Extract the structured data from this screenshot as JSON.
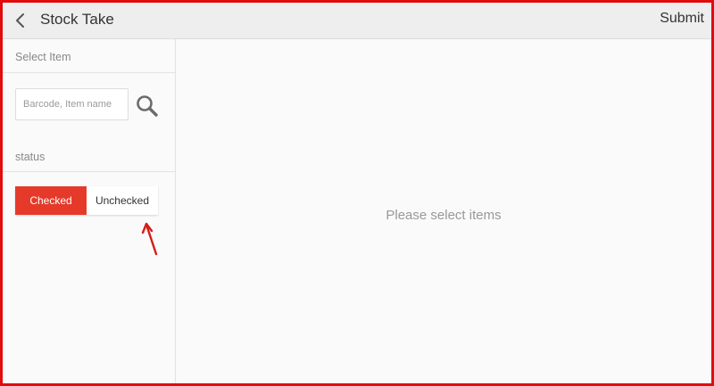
{
  "header": {
    "title": "Stock Take",
    "submit_label": "Submit",
    "back_icon": "chevron-left-icon"
  },
  "sidebar": {
    "select_item_label": "Select Item",
    "search": {
      "placeholder": "Barcode, Item name",
      "value": "",
      "icon": "search-icon"
    },
    "status_label": "status",
    "status_toggle": {
      "options": [
        "Checked",
        "Unchecked"
      ],
      "selected": "Checked"
    }
  },
  "main": {
    "empty_message": "Please select items"
  },
  "colors": {
    "accent": "#e53a2a",
    "frame_border": "#e10c0c",
    "annotation_arrow": "#d81b1b"
  }
}
